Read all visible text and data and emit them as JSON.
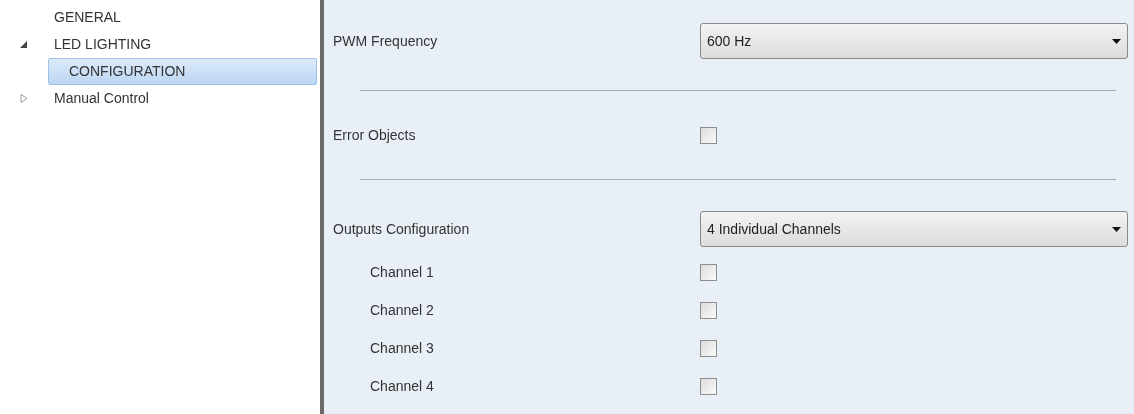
{
  "sidebar": {
    "items": [
      {
        "label": "GENERAL",
        "kind": "page",
        "selected": false
      },
      {
        "label": "LED LIGHTING",
        "kind": "folder",
        "expanded": true,
        "selected": false,
        "children": [
          {
            "label": "CONFIGURATION",
            "selected": true
          }
        ]
      },
      {
        "label": "Manual Control",
        "kind": "folder",
        "expanded": false,
        "selected": false
      }
    ]
  },
  "parameters": [
    {
      "kind": "select",
      "label": "PWM Frequency",
      "value": "600 Hz"
    },
    {
      "kind": "separator"
    },
    {
      "kind": "checkbox",
      "label": "Error Objects",
      "checked": false
    },
    {
      "kind": "separator"
    },
    {
      "kind": "select",
      "label": "Outputs Configuration",
      "value": "4 Individual Channels",
      "children": [
        {
          "kind": "checkbox",
          "label": "Channel 1",
          "checked": false
        },
        {
          "kind": "checkbox",
          "label": "Channel 2",
          "checked": false
        },
        {
          "kind": "checkbox",
          "label": "Channel 3",
          "checked": false
        },
        {
          "kind": "checkbox",
          "label": "Channel 4",
          "checked": false
        }
      ]
    }
  ]
}
